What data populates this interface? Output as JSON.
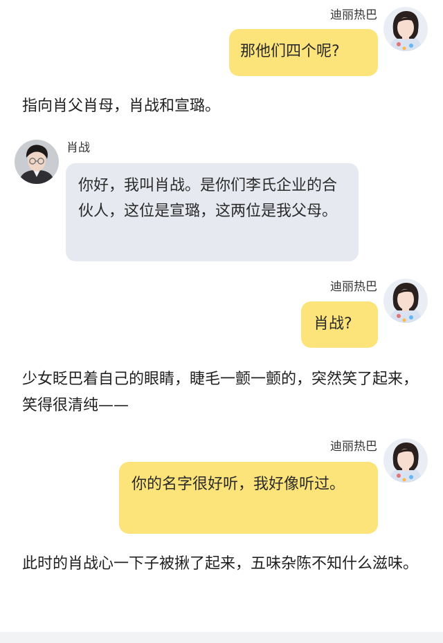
{
  "messages": [
    {
      "name": "迪丽热巴",
      "text": "那他们四个呢?"
    },
    {
      "narration": "指向肖父肖母，肖战和宣璐。"
    },
    {
      "name": "肖战",
      "text": "你好，我叫肖战。是你们李氏企业的合伙人，这位是宣璐，这两位是我父母。"
    },
    {
      "name": "迪丽热巴",
      "text": "肖战?"
    },
    {
      "narration": "少女眨巴着自己的眼睛，睫毛一颤一颤的，突然笑了起来，笑得很清纯——"
    },
    {
      "name": "迪丽热巴",
      "text": "你的名字很好听，我好像听过。"
    },
    {
      "narration": "此时的肖战心一下子被揪了起来，五味杂陈不知什么滋味。"
    }
  ],
  "colors": {
    "right_bubble": "#fde47a",
    "left_bubble": "#e6e9ef"
  },
  "icons": {
    "female_avatar": "female-avatar",
    "male_avatar": "male-avatar"
  }
}
